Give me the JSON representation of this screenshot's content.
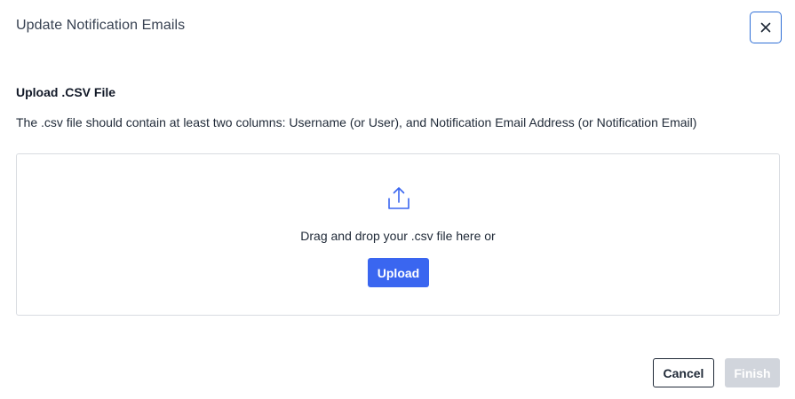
{
  "dialog": {
    "title": "Update Notification Emails",
    "close_icon": "close-icon"
  },
  "upload": {
    "section_title": "Upload .CSV File",
    "description": "The .csv file should contain at least two columns: Username (or User), and Notification Email Address (or Notification Email)",
    "drop_text": "Drag and drop your .csv file here or",
    "upload_icon": "upload-icon",
    "upload_button_label": "Upload"
  },
  "footer": {
    "cancel_label": "Cancel",
    "finish_label": "Finish",
    "finish_disabled": true
  },
  "colors": {
    "primary": "#3a66f0",
    "close_border": "#2f6fd6",
    "disabled": "#d1d5dc",
    "border": "#d9dce1"
  }
}
